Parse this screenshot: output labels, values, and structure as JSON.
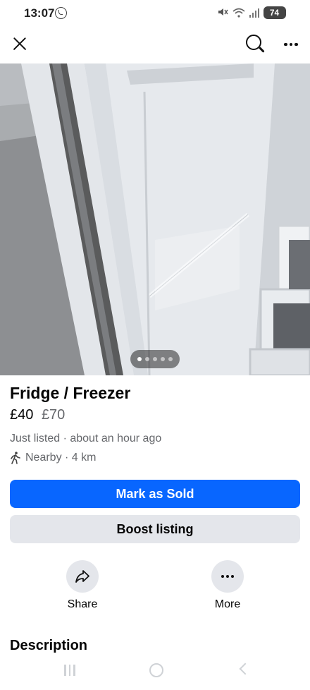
{
  "status_bar": {
    "time": "13:07",
    "battery": "74",
    "icons": [
      "whatsapp-icon",
      "mute-icon",
      "wifi-icon",
      "signal-icon",
      "battery-icon"
    ]
  },
  "top_bar": {
    "icons": [
      "close-icon",
      "search-icon",
      "more-options-icon"
    ]
  },
  "photo": {
    "photo_count": 5,
    "current_index": 1
  },
  "listing": {
    "title": "Fridge / Freezer",
    "price": "£40",
    "original_price": "£70",
    "listed": "Just listed · about an hour ago",
    "location": "Nearby · 4 km"
  },
  "buttons": {
    "mark_sold": "Mark as Sold",
    "boost": "Boost listing"
  },
  "actions": {
    "share": "Share",
    "more": "More"
  },
  "description": {
    "heading": "Description"
  },
  "colors": {
    "primary": "#0866ff",
    "secondary_button": "#e4e6eb",
    "muted_text": "#65676b"
  }
}
